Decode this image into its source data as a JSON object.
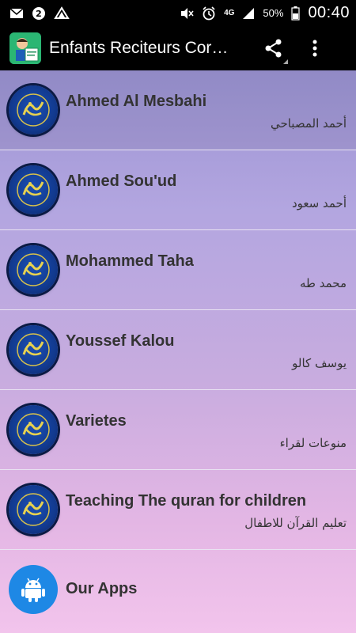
{
  "status_bar": {
    "network": "4G",
    "battery": "50%",
    "time": "00:40",
    "icons": [
      "gmail-icon",
      "notification-2-icon",
      "app-notification-icon",
      "mute-icon",
      "alarm-icon",
      "signal-icon",
      "battery-icon"
    ]
  },
  "action_bar": {
    "title": "Enfants  Reciteurs Cor…",
    "share_icon": "share-icon",
    "overflow_icon": "overflow-menu-icon"
  },
  "items": [
    {
      "name": "Ahmed Al Mesbahi",
      "arabic": "أحمد المصباحي"
    },
    {
      "name": "Ahmed Sou'ud",
      "arabic": "أحمد سعود"
    },
    {
      "name": "Mohammed Taha",
      "arabic": "محمد طه"
    },
    {
      "name": "Youssef Kalou",
      "arabic": "يوسف كالو"
    },
    {
      "name": "Varietes",
      "arabic": "منوعات لقراء"
    },
    {
      "name": "Teaching The quran for children",
      "arabic": "تعليم القرآن للاطفال"
    }
  ],
  "our_apps": {
    "label": "Our Apps",
    "icon": "android-icon"
  },
  "colors": {
    "list_top": "#9b93d3",
    "list_bottom": "#f2c4ec",
    "quran_badge": "#123a8f",
    "android_blue": "#1e88e5",
    "logo_green": "#2bb673"
  }
}
